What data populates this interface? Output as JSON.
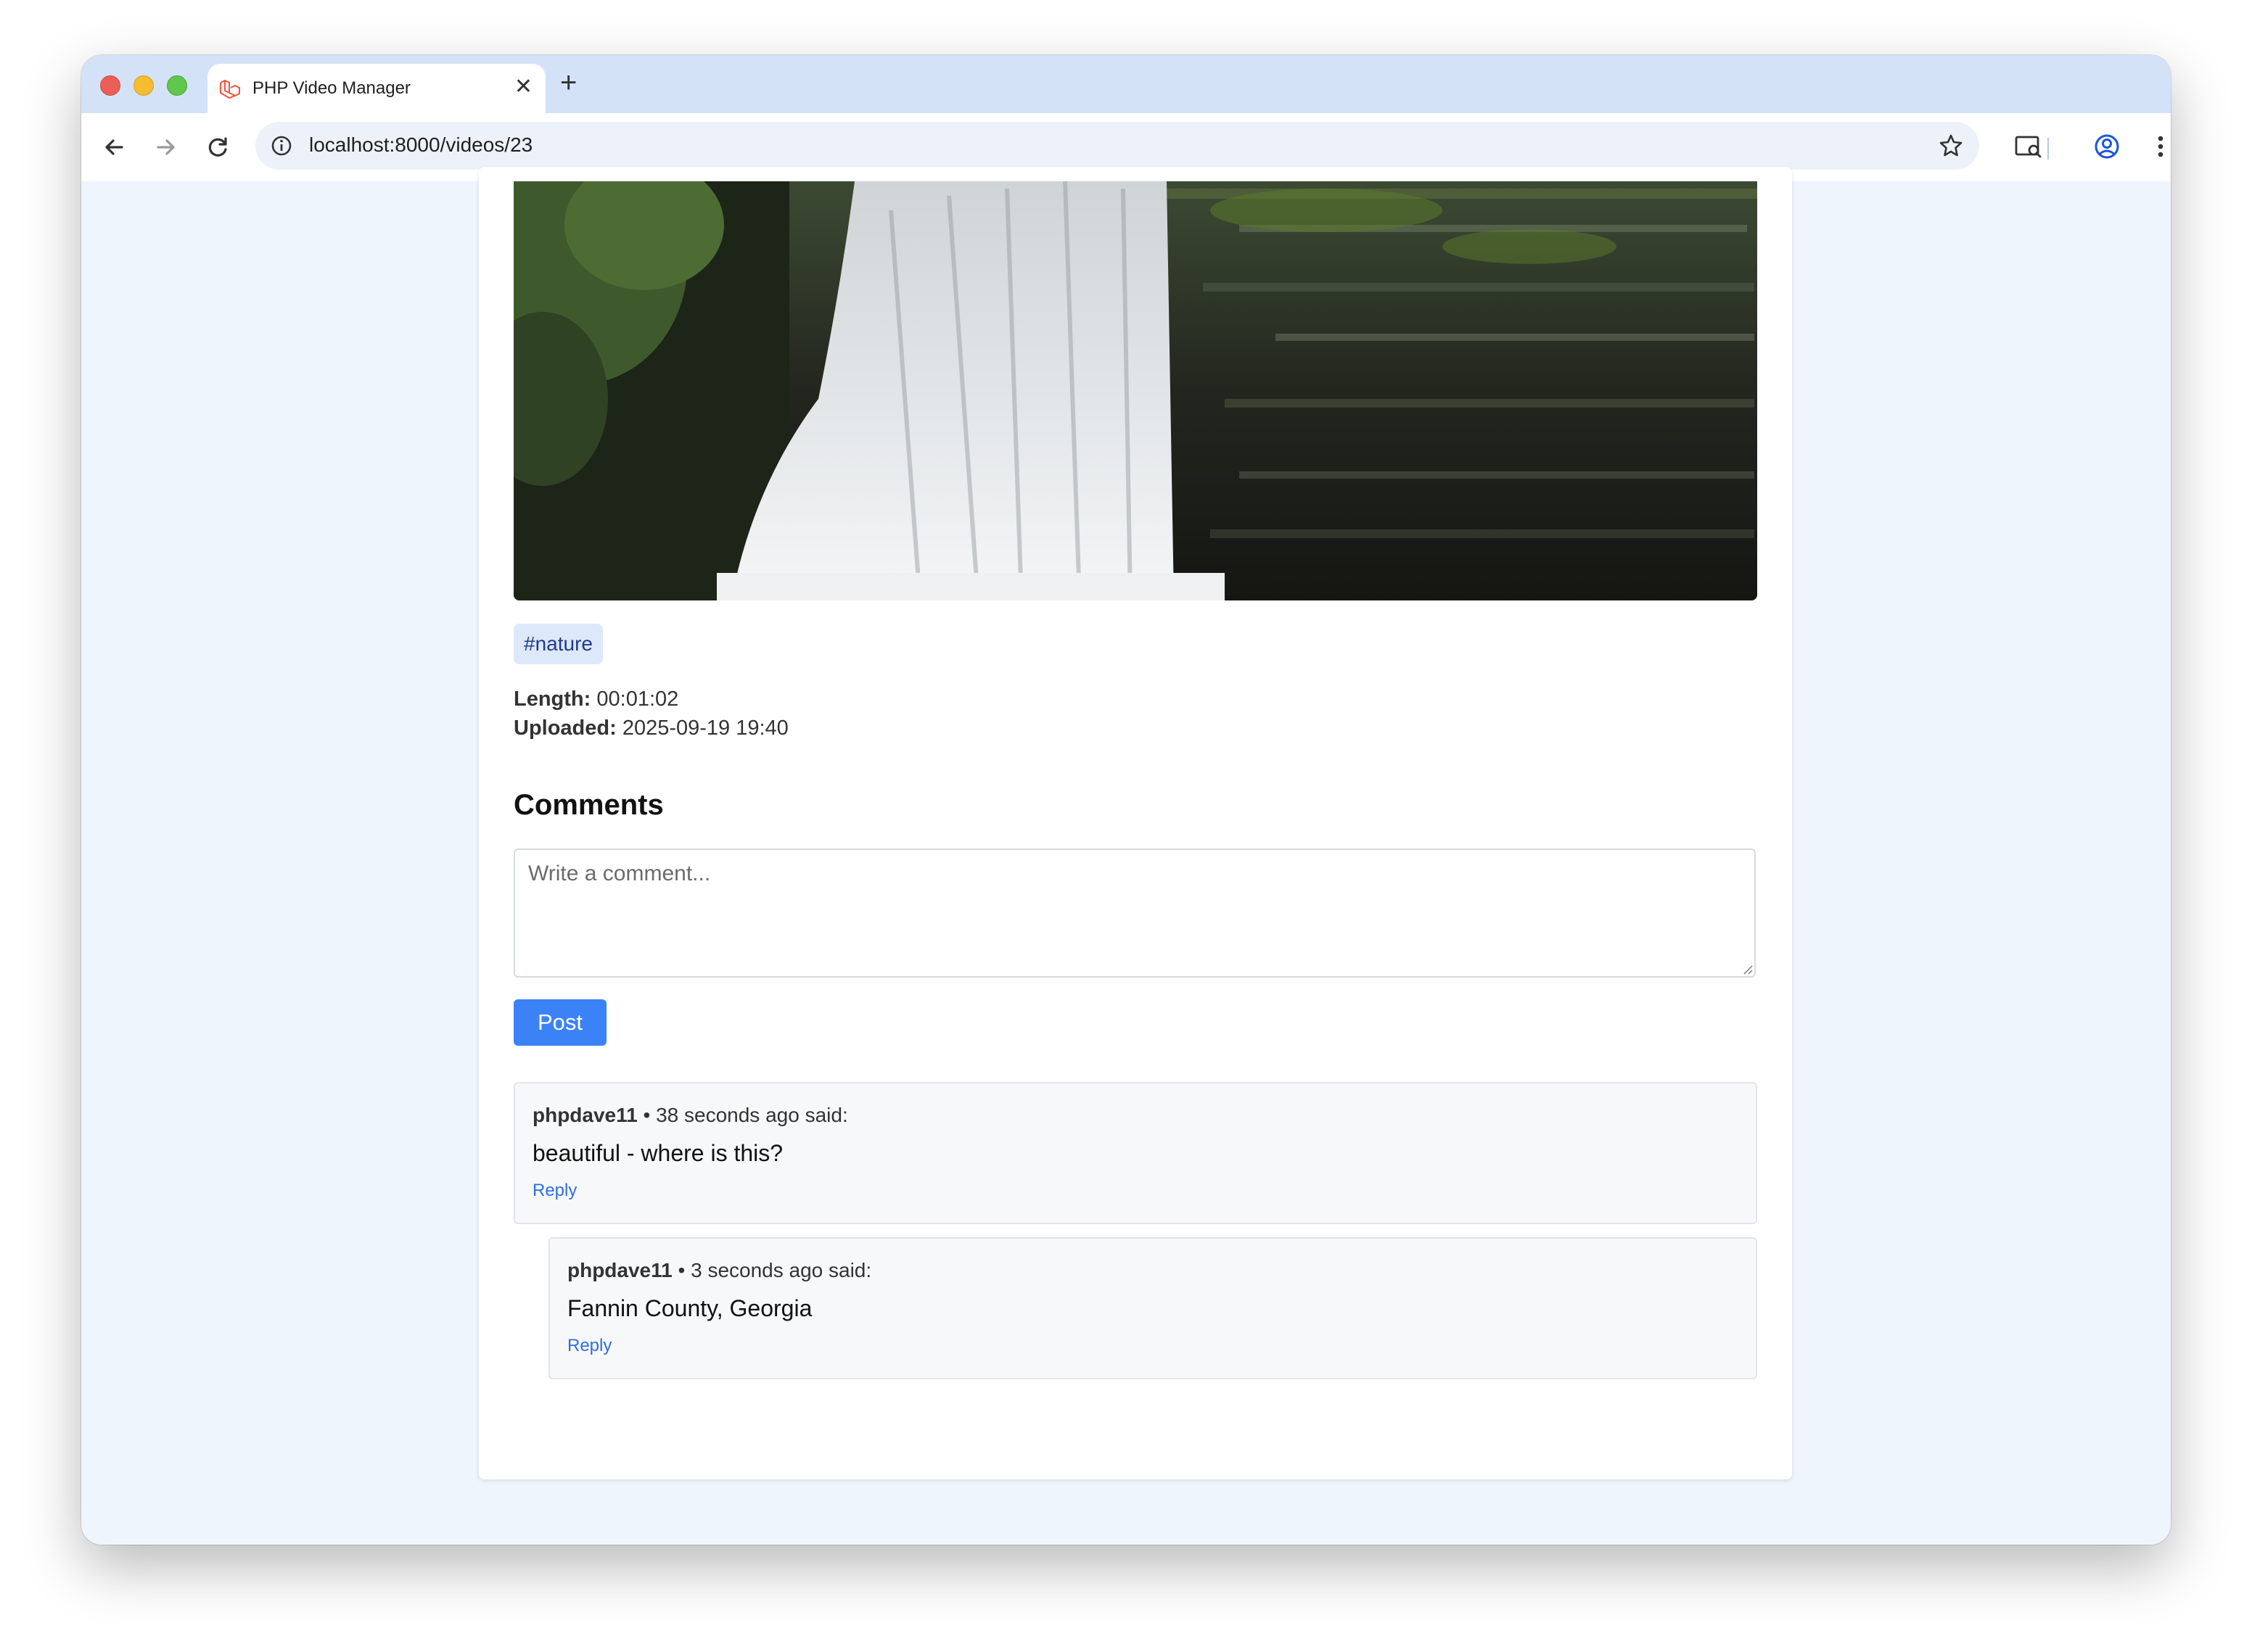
{
  "browser": {
    "tab_title": "PHP Video Manager",
    "url": "localhost:8000/videos/23",
    "new_tab_label": "+",
    "close_label": "✕"
  },
  "video": {
    "tag": "#nature",
    "length_label": "Length:",
    "length_value": "00:01:02",
    "uploaded_label": "Uploaded:",
    "uploaded_value": "2025-09-19 19:40"
  },
  "comments": {
    "heading": "Comments",
    "placeholder": "Write a comment...",
    "post_label": "Post",
    "items": [
      {
        "author": "phpdave11",
        "meta": "• 38 seconds ago said:",
        "body": "beautiful - where is this?",
        "reply_label": "Reply"
      },
      {
        "author": "phpdave11",
        "meta": "• 3 seconds ago said:",
        "body": "Fannin County, Georgia",
        "reply_label": "Reply"
      }
    ]
  },
  "colors": {
    "accent": "#3b82f6",
    "page_bg": "#eff5fd",
    "titlebar": "#d4e2f8",
    "tag_bg": "#dde8fb",
    "link": "#2f6ee0"
  },
  "icons": [
    "laravel-logo-icon",
    "back-arrow-icon",
    "forward-arrow-icon",
    "reload-icon",
    "site-info-icon",
    "bookmark-star-icon",
    "cast-search-icon",
    "profile-icon",
    "menu-dots-icon"
  ]
}
